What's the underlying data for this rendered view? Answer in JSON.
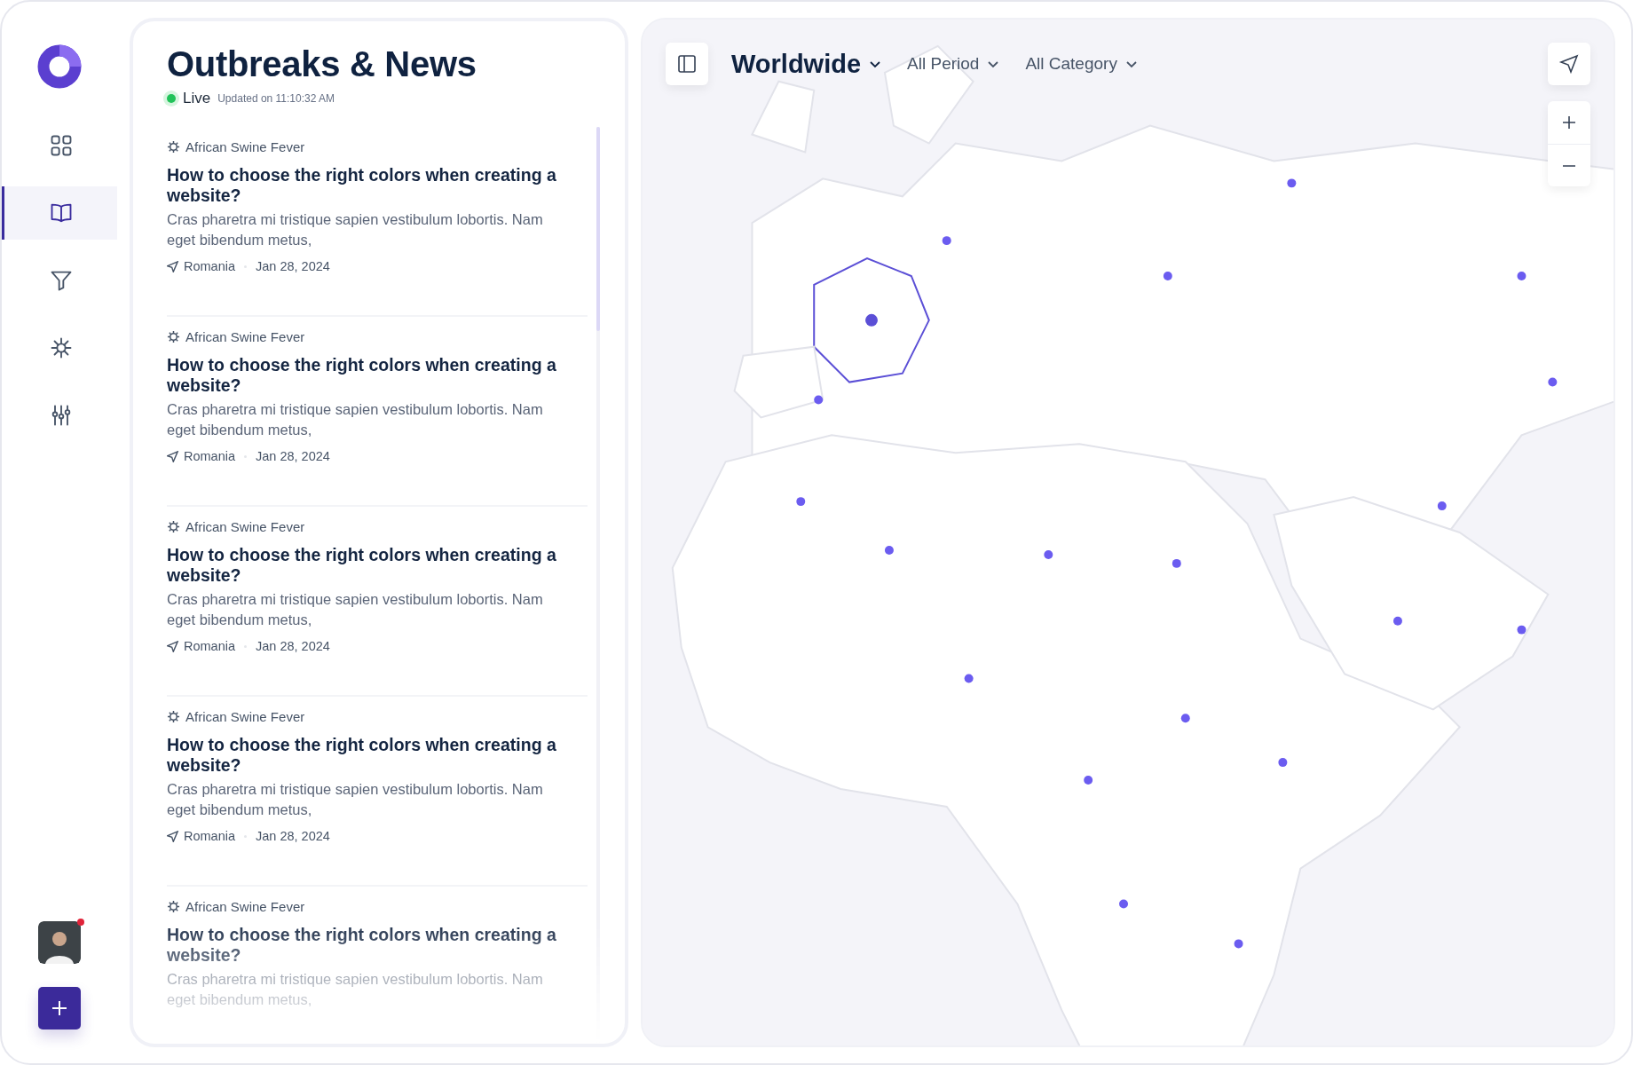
{
  "nav": [
    {
      "kind": "grid",
      "selected": false
    },
    {
      "kind": "book",
      "selected": true
    },
    {
      "kind": "filter",
      "selected": false
    },
    {
      "kind": "virus",
      "selected": false
    },
    {
      "kind": "sliders",
      "selected": false
    }
  ],
  "user": {
    "notification": true
  },
  "panel": {
    "title": "Outbreaks & News",
    "live": "Live",
    "updated": "Updated on 11:10:32 AM"
  },
  "news": [
    {
      "category": "African Swine Fever",
      "title": "How to choose the right colors when creating a website?",
      "summary": "Cras pharetra mi tristique sapien vestibulum lobortis. Nam eget bibendum metus,",
      "location": "Romania",
      "date": "Jan 28, 2024"
    },
    {
      "category": "African Swine Fever",
      "title": "How to choose the right colors when creating a website?",
      "summary": "Cras pharetra mi tristique sapien vestibulum lobortis. Nam eget bibendum metus,",
      "location": "Romania",
      "date": "Jan 28, 2024"
    },
    {
      "category": "African Swine Fever",
      "title": "How to choose the right colors when creating a website?",
      "summary": "Cras pharetra mi tristique sapien vestibulum lobortis. Nam eget bibendum metus,",
      "location": "Romania",
      "date": "Jan 28, 2024"
    },
    {
      "category": "African Swine Fever",
      "title": "How to choose the right colors when creating a website?",
      "summary": "Cras pharetra mi tristique sapien vestibulum lobortis. Nam eget bibendum metus,",
      "location": "Romania",
      "date": "Jan 28, 2024"
    },
    {
      "category": "African Swine Fever",
      "title": "How to choose the right colors when creating a website?",
      "summary": "Cras pharetra mi tristique sapien vestibulum lobortis. Nam eget bibendum metus,"
    }
  ],
  "map": {
    "region": "Worldwide",
    "filters": [
      "All Period",
      "All Category"
    ]
  }
}
